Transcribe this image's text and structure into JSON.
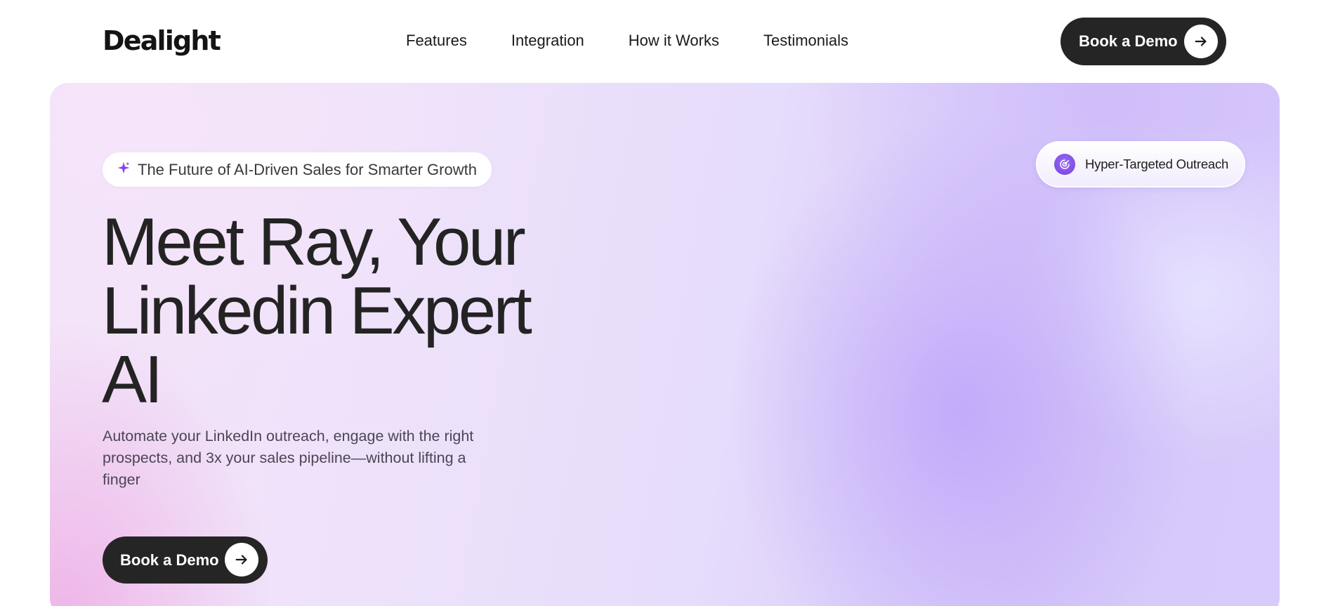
{
  "brand": {
    "logo_text": "Dealight"
  },
  "nav": {
    "items": [
      {
        "label": "Features"
      },
      {
        "label": "Integration"
      },
      {
        "label": "How it Works"
      },
      {
        "label": "Testimonials"
      }
    ]
  },
  "header": {
    "cta_label": "Book a Demo",
    "cta_icon": "arrow-right-icon"
  },
  "hero": {
    "badge_icon": "sparkle-icon",
    "badge_text": "The Future of AI-Driven Sales for Smarter Growth",
    "headline_lines": [
      "Meet Ray, Your",
      "Linkedin Expert",
      "AI"
    ],
    "subtitle": "Automate your LinkedIn outreach, engage with the right prospects, and 3x your sales pipeline—without lifting a finger",
    "cta_label": "Book a Demo",
    "cta_icon": "arrow-right-icon",
    "feature_tag": {
      "icon": "target-icon",
      "label": "Hyper-Targeted Outreach"
    }
  },
  "colors": {
    "accent_purple": "#7c4dea",
    "button_dark": "#252525",
    "hero_gradient_start": "#f3e4f8",
    "hero_gradient_end": "#d6c8f8"
  }
}
